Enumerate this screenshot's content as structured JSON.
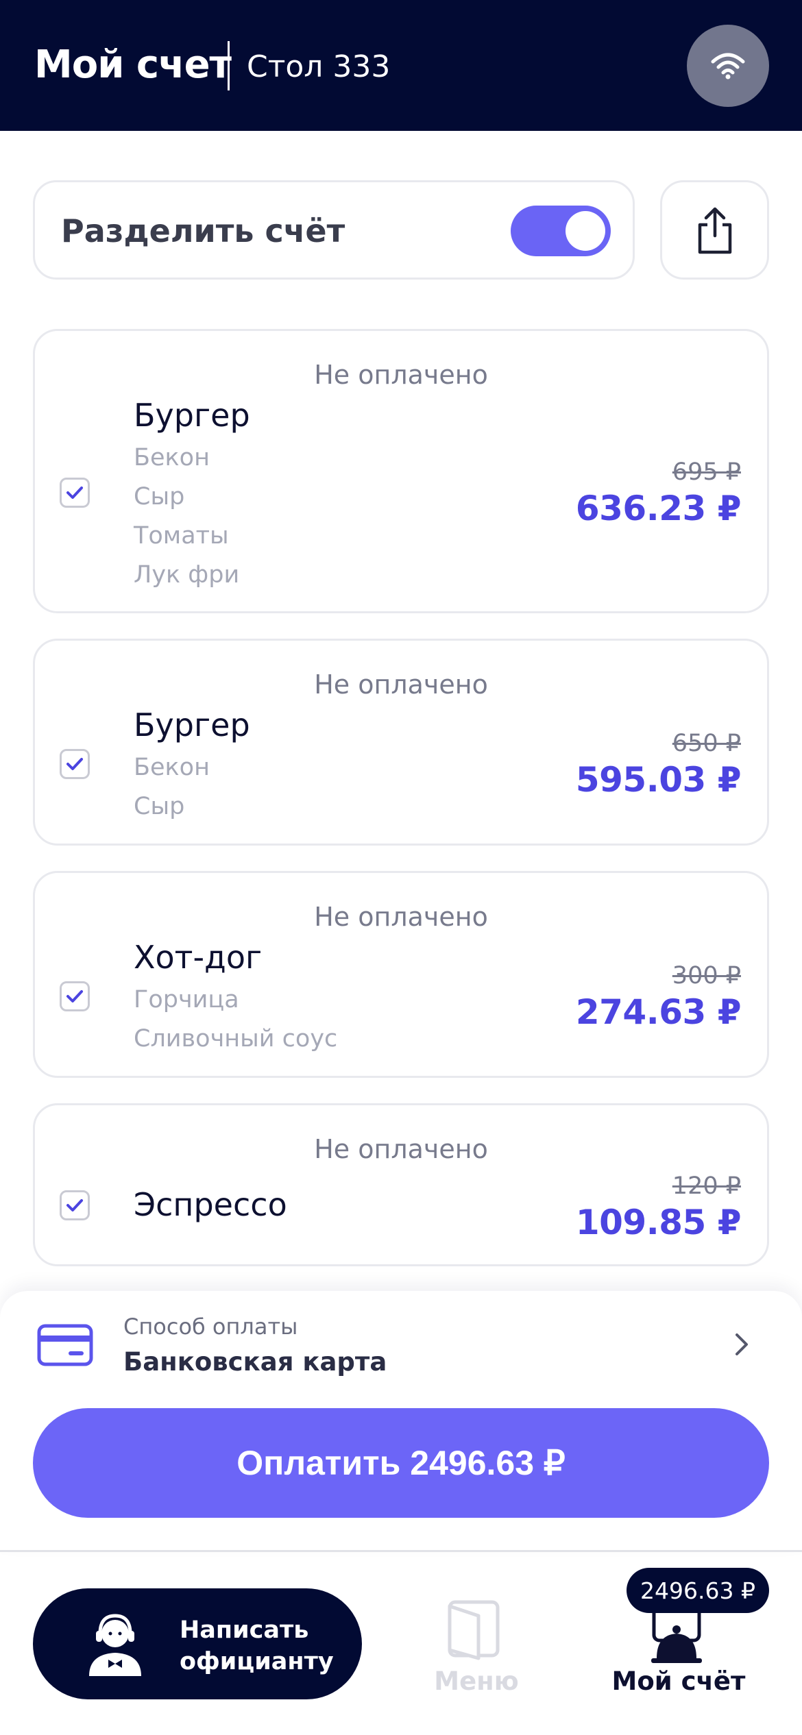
{
  "header": {
    "title": "Мой счет",
    "table": "Стол 333",
    "wifi_icon": "wifi-icon"
  },
  "split": {
    "label": "Разделить счёт",
    "enabled": true
  },
  "share_icon": "share-icon",
  "items": [
    {
      "status": "Не оплачено",
      "name": "Бургер",
      "modifiers": [
        "Бекон",
        "Сыр",
        "Томаты",
        "Лук фри"
      ],
      "old_price": "695 ₽",
      "price": "636.23 ₽",
      "checked": true
    },
    {
      "status": "Не оплачено",
      "name": "Бургер",
      "modifiers": [
        "Бекон",
        "Сыр"
      ],
      "old_price": "650 ₽",
      "price": "595.03 ₽",
      "checked": true
    },
    {
      "status": "Не оплачено",
      "name": "Хот-дог",
      "modifiers": [
        "Горчица",
        "Сливочный соус"
      ],
      "old_price": "300 ₽",
      "price": "274.63 ₽",
      "checked": true
    },
    {
      "status": "Не оплачено",
      "name": "Эспрессо",
      "modifiers": [],
      "old_price": "120 ₽",
      "price": "109.85 ₽",
      "checked": true
    }
  ],
  "payment": {
    "label": "Способ оплаты",
    "method": "Банковская карта",
    "button": "Оплатить 2496.63 ₽"
  },
  "bottom": {
    "waiter_line1": "Написать",
    "waiter_line2": "официанту",
    "menu_label": "Меню",
    "bill_label": "Мой счёт",
    "bill_badge": "2496.63 ₽"
  },
  "colors": {
    "header_bg": "#020a33",
    "accent": "#6c65f7",
    "price": "#4b44e0"
  }
}
